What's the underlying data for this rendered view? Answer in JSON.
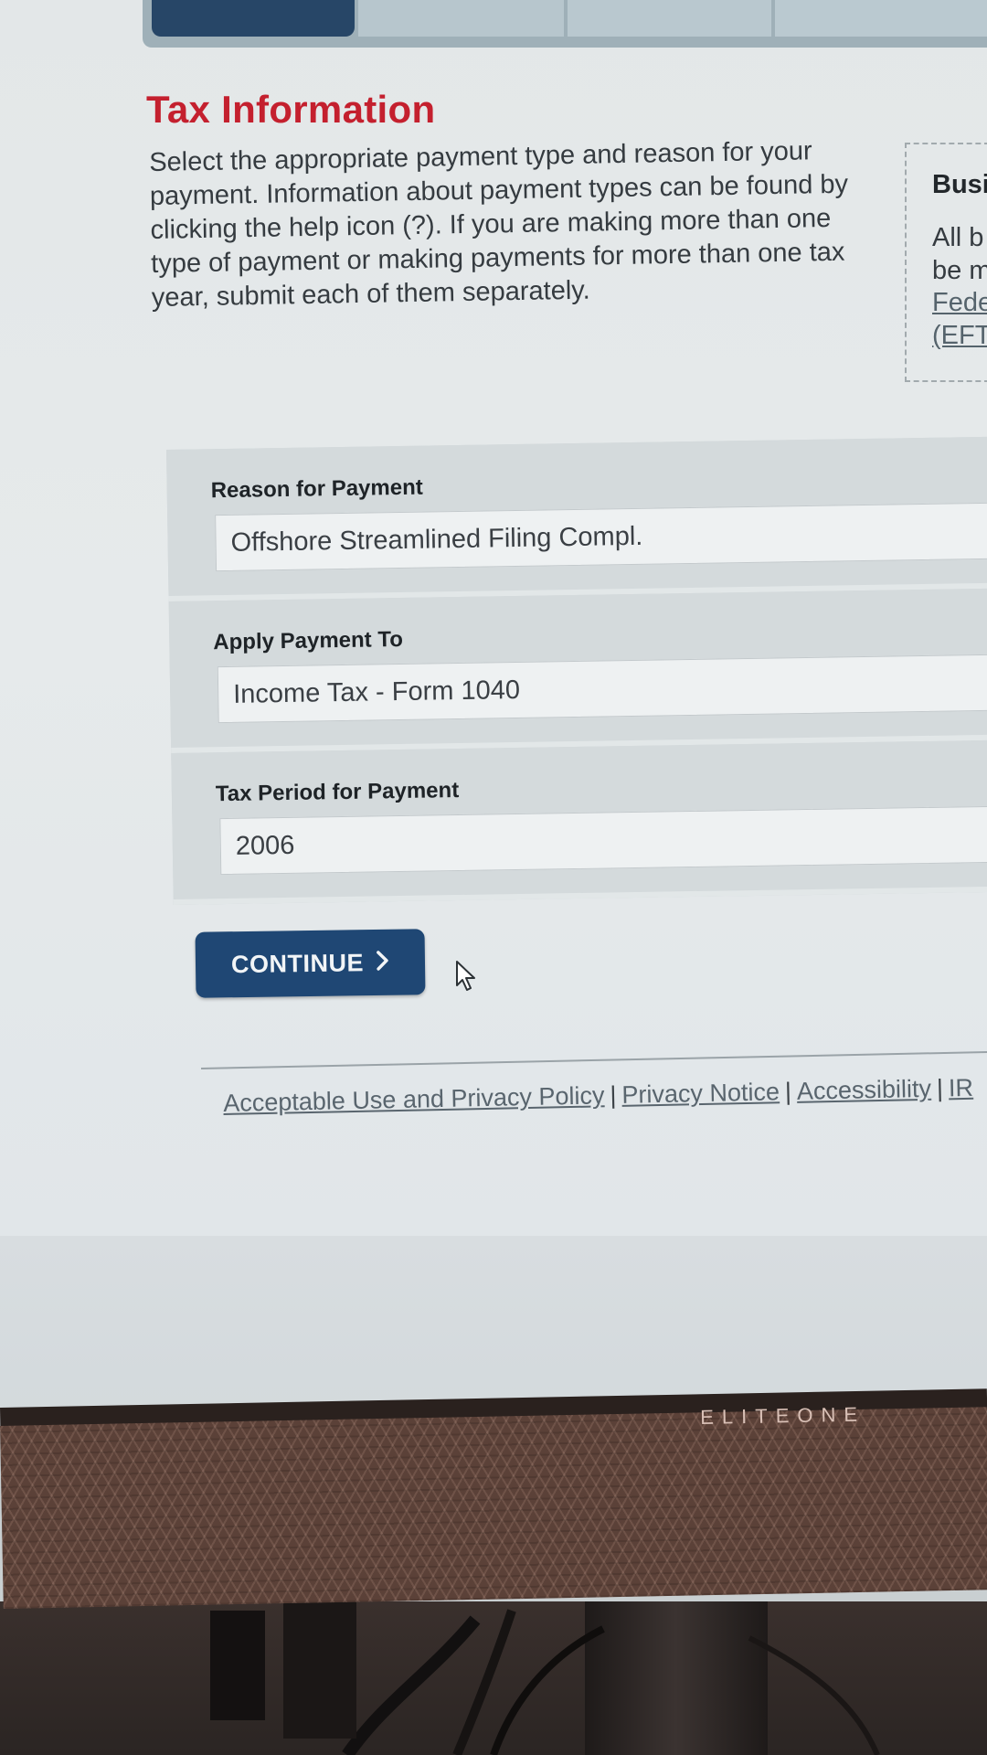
{
  "page": {
    "title": "Tax Information",
    "intro": "Select the appropriate payment type and reason for your payment. Information about payment types can be found by clicking the help icon (?). If you are making more than one type of payment or making payments for more than one tax year, submit each of them separately."
  },
  "side_box": {
    "title": "Busi",
    "line1": "All b",
    "line2": "be m",
    "link1": "Fede",
    "link2": "(EFT"
  },
  "form": {
    "reason_label": "Reason for Payment",
    "reason_value": "Offshore Streamlined Filing Compl.",
    "apply_label": "Apply Payment To",
    "apply_value": "Income Tax - Form 1040",
    "period_label": "Tax Period for Payment",
    "period_value": "2006"
  },
  "actions": {
    "continue_label": "CONTINUE",
    "continue_chevron": "›"
  },
  "footer": {
    "links": [
      "Acceptable Use and Privacy Policy",
      "Privacy Notice",
      "Accessibility",
      "IR"
    ],
    "separator": "|"
  },
  "monitor": {
    "brand": "ELITEONE"
  },
  "colors": {
    "title_red": "#c4202e",
    "button_navy": "#1f4774",
    "active_tab": "#274667"
  },
  "icons": {
    "cursor": "mouse-pointer-icon",
    "chevron": "chevron-right-icon"
  }
}
